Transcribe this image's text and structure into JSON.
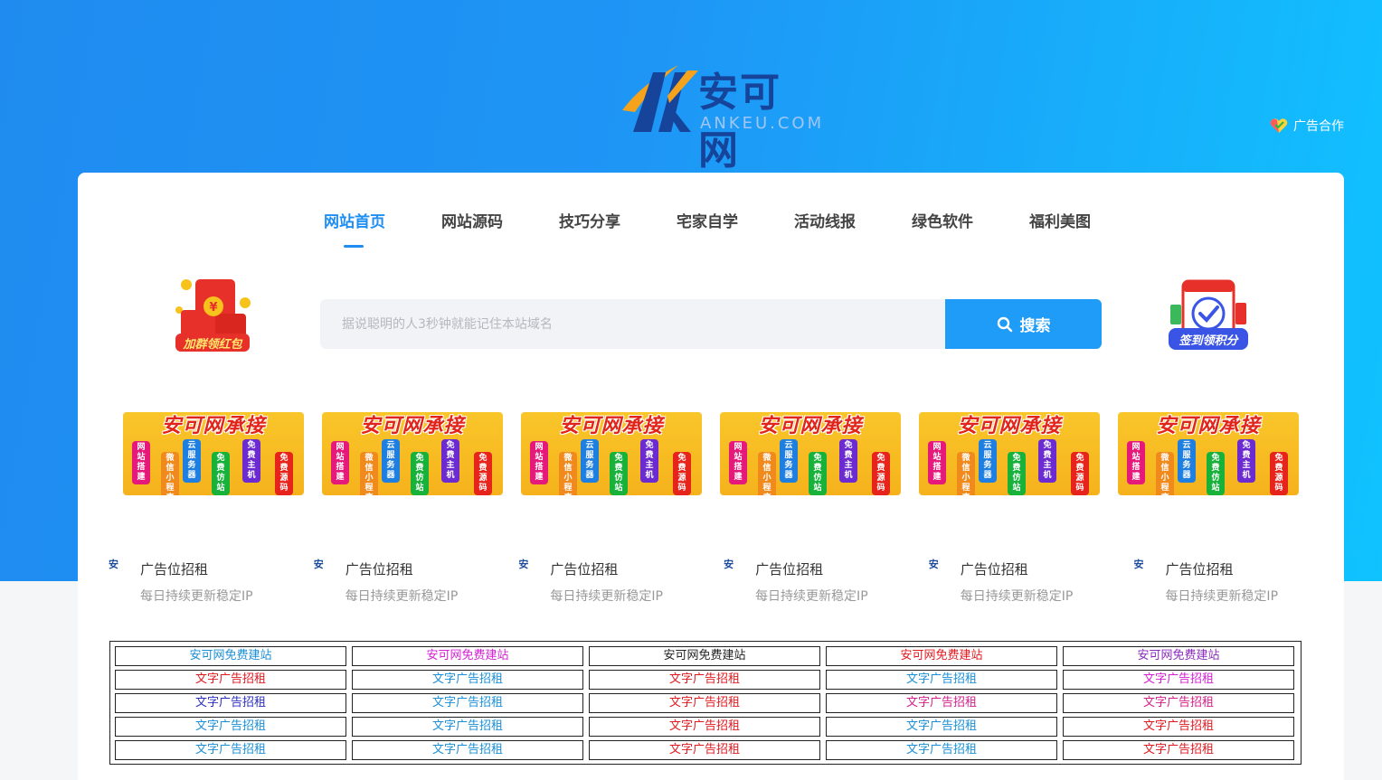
{
  "header": {
    "logo_text": "安可网",
    "logo_sub": "ANKEU.COM",
    "ad_link": "广告合作"
  },
  "nav": {
    "items": [
      "网站首页",
      "网站源码",
      "技巧分享",
      "宅家自学",
      "活动线报",
      "绿色软件",
      "福利美图"
    ],
    "active_index": 0
  },
  "promo": {
    "left_label": "加群领红包",
    "right_label": "签到领积分"
  },
  "search": {
    "placeholder": "据说聪明的人3秒钟就能记住本站域名",
    "button_label": "搜索"
  },
  "banners": {
    "title": "安可网承接",
    "pills": [
      "网站搭建",
      "微信小程序",
      "云服务器",
      "免费仿站",
      "免费主机",
      "免费源码"
    ],
    "pill_colors": [
      "#e4197a",
      "#f08a1c",
      "#1e7fe0",
      "#18b23a",
      "#6b2bd1",
      "#e6241c"
    ],
    "count": 6
  },
  "ad_cards": [
    {
      "icon": "安",
      "title": "广告位招租",
      "subtitle": "每日持续更新稳定IP"
    },
    {
      "icon": "安",
      "title": "广告位招租",
      "subtitle": "每日持续更新稳定IP"
    },
    {
      "icon": "安",
      "title": "广告位招租",
      "subtitle": "每日持续更新稳定IP"
    },
    {
      "icon": "安",
      "title": "广告位招租",
      "subtitle": "每日持续更新稳定IP"
    },
    {
      "icon": "安",
      "title": "广告位招租",
      "subtitle": "每日持续更新稳定IP"
    },
    {
      "icon": "安",
      "title": "广告位招租",
      "subtitle": "每日持续更新稳定IP"
    }
  ],
  "text_links": [
    [
      {
        "text": "安可网免费建站",
        "color": "#1a8fd6"
      },
      {
        "text": "安可网免费建站",
        "color": "#d41fd4"
      },
      {
        "text": "安可网免费建站",
        "color": "#222222"
      },
      {
        "text": "安可网免费建站",
        "color": "#e0191f"
      },
      {
        "text": "安可网免费建站",
        "color": "#8a2bbd"
      }
    ],
    [
      {
        "text": "文字广告招租",
        "color": "#e0191f"
      },
      {
        "text": "文字广告招租",
        "color": "#1a8fd6"
      },
      {
        "text": "文字广告招租",
        "color": "#e0191f"
      },
      {
        "text": "文字广告招租",
        "color": "#1a8fd6"
      },
      {
        "text": "文字广告招租",
        "color": "#d41fd4"
      }
    ],
    [
      {
        "text": "文字广告招租",
        "color": "#2a2fbd"
      },
      {
        "text": "文字广告招租",
        "color": "#1a8fd6"
      },
      {
        "text": "文字广告招租",
        "color": "#e0191f"
      },
      {
        "text": "文字广告招租",
        "color": "#d41f8a"
      },
      {
        "text": "文字广告招租",
        "color": "#d41f8a"
      }
    ],
    [
      {
        "text": "文字广告招租",
        "color": "#1a8fd6"
      },
      {
        "text": "文字广告招租",
        "color": "#1a8fd6"
      },
      {
        "text": "文字广告招租",
        "color": "#e0191f"
      },
      {
        "text": "文字广告招租",
        "color": "#1a8fd6"
      },
      {
        "text": "文字广告招租",
        "color": "#e0191f"
      }
    ],
    [
      {
        "text": "文字广告招租",
        "color": "#1a8fd6"
      },
      {
        "text": "文字广告招租",
        "color": "#1a8fd6"
      },
      {
        "text": "文字广告招租",
        "color": "#e0191f"
      },
      {
        "text": "文字广告招租",
        "color": "#1a8fd6"
      },
      {
        "text": "文字广告招租",
        "color": "#e0191f"
      }
    ]
  ]
}
